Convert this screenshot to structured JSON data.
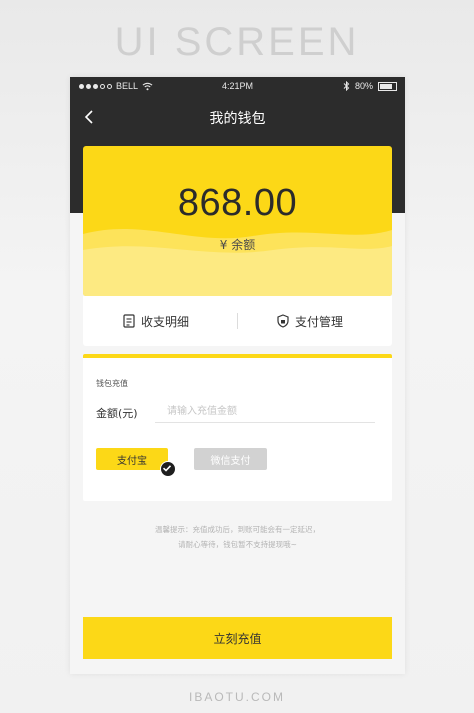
{
  "banner": "UI SCREEN",
  "footer": "IBAOTU.COM",
  "status_bar": {
    "carrier": "BELL",
    "time": "4:21PM",
    "battery": "80%"
  },
  "nav": {
    "title": "我的钱包"
  },
  "wallet": {
    "balance": "868.00",
    "balance_label": "¥ 余额"
  },
  "actions": {
    "statement": "收支明细",
    "payment_management": "支付管理"
  },
  "recharge": {
    "section_label": "钱包充值",
    "amount_label": "金额(元)",
    "amount_value": "",
    "amount_placeholder": "请输入充值金额",
    "methods": [
      {
        "label": "支付宝",
        "selected": true
      },
      {
        "label": "微信支付",
        "selected": false
      }
    ]
  },
  "tips": {
    "line1": "温馨提示：充值成功后，到账可能会有一定延迟，",
    "line2": "请耐心等待，钱包暂不支持提现哦~"
  },
  "submit_label": "立刻充值",
  "colors": {
    "accent": "#fcd817",
    "dark_header": "#2c2c2c",
    "disabled": "#d2d2d2"
  }
}
